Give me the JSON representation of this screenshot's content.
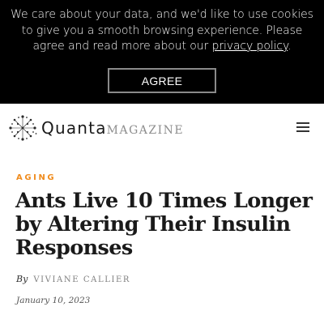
{
  "cookie_banner": {
    "text": "We care about your data, and we'd like to use cookies to give you a smooth browsing experience. Please agree and read more about our ",
    "link_text": "privacy policy",
    "text_end": ".",
    "agree_label": "AGREE"
  },
  "header": {
    "logo_primary": "Quanta",
    "logo_secondary": "magazine",
    "menu_icon": "hamburger-menu-icon"
  },
  "article": {
    "category": "AGING",
    "title": "Ants Live 10 Times Longer by Altering Their Insulin Responses",
    "byline_prefix": "By",
    "author": "VIVIANE CALLIER",
    "date": "January 10, 2023"
  },
  "colors": {
    "accent": "#f08c1e",
    "banner_bg": "#000000"
  }
}
